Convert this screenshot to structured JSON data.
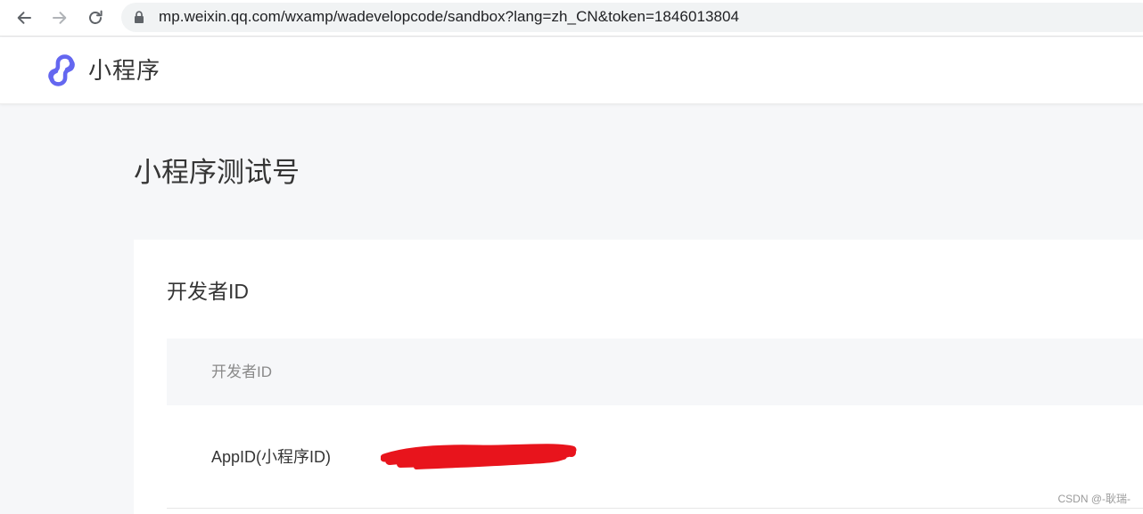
{
  "browser": {
    "url": "mp.weixin.qq.com/wxamp/wadevelopcode/sandbox?lang=zh_CN&token=1846013804"
  },
  "header": {
    "logo_text": "小程序",
    "brand_color": "#6467f0"
  },
  "page": {
    "title": "小程序测试号"
  },
  "developer_section": {
    "title": "开发者ID",
    "table_header": "开发者ID",
    "rows": [
      {
        "label": "AppID(小程序ID)",
        "value_redacted": true
      }
    ],
    "redaction_color": "#e8141c"
  },
  "watermark": "CSDN @-耿瑞-"
}
